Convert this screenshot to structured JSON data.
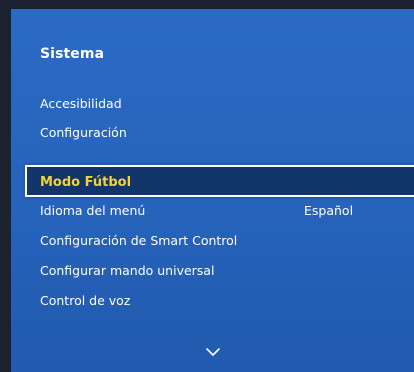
{
  "panel": {
    "title": "Sistema"
  },
  "menu": {
    "items": [
      {
        "label": "Accesibilidad"
      },
      {
        "label": "Configuración"
      },
      {
        "label": "Modo Fútbol",
        "selected": true
      },
      {
        "label": "Idioma del menú",
        "value": "Español"
      },
      {
        "label": "Configuración de Smart Control"
      },
      {
        "label": "Configurar mando universal"
      },
      {
        "label": "Control de voz"
      }
    ]
  },
  "icons": {
    "scroll_down": "chevron-down-icon"
  },
  "colors": {
    "panel_blue": "#2a6bc6",
    "selected_bg": "#12366a",
    "selected_text": "#f0d23a",
    "text": "#ffffff"
  }
}
